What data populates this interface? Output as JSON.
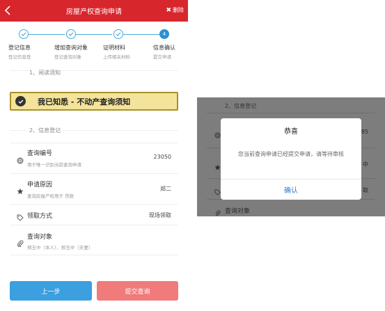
{
  "header": {
    "title": "房屋产权查询申请",
    "delete_label": "删除"
  },
  "stepper": {
    "steps": [
      {
        "label": "登记信息",
        "sub": "登记信息登"
      },
      {
        "label": "增加查询对象",
        "sub": "登记查询对象"
      },
      {
        "label": "证明材料",
        "sub": "上传相关材料"
      },
      {
        "label": "信息确认",
        "sub": "提交申请",
        "number": "4"
      }
    ]
  },
  "sections": {
    "read_notice": "1、阅读须知",
    "info_register": "2、信息登记"
  },
  "notice": {
    "text": "我已知悉 - 不动产查询须知"
  },
  "fields": [
    {
      "label": "查询编号",
      "sub": "用于唯一识别当前查询申请",
      "value": "23050",
      "icon": "fingerprint-icon"
    },
    {
      "label": "申请原因",
      "sub": "查询房屋产权用于 贷款",
      "value": "郑二",
      "icon": "star-icon"
    },
    {
      "label": "领取方式",
      "sub": "",
      "value": "现场领取",
      "icon": "tag-icon"
    },
    {
      "label": "查询对象",
      "sub": "郑玉中（本人）、郑玉中（夫妻）",
      "value": "",
      "icon": "paperclip-icon"
    }
  ],
  "buttons": {
    "prev": "上一步",
    "submit": "提交查询"
  },
  "background": {
    "section": "2、信息登记",
    "value_top": "85",
    "value_mid": "中",
    "value_low": "取",
    "last_label": "查询对象"
  },
  "dialog": {
    "title": "恭喜",
    "message": "您当前查询申请已经提交申请，请等待审核",
    "confirm": "确认"
  },
  "colors": {
    "header": "#d8262d",
    "step": "#2e90d2",
    "prev_button": "#3b9fe0",
    "submit_button": "#f17a7a",
    "notice_bg": "#f4e39a",
    "link": "#2e7ec8"
  }
}
